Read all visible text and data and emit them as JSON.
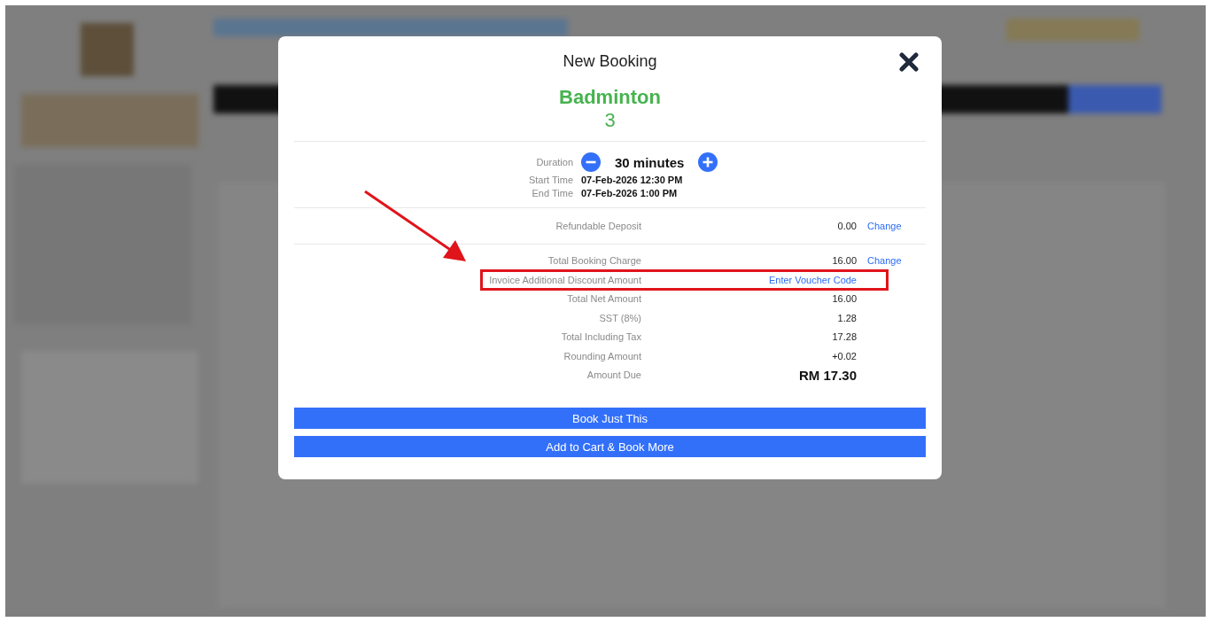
{
  "dialog": {
    "title": "New Booking",
    "facility": "Badminton",
    "court": "3",
    "duration": {
      "label": "Duration",
      "value": "30 minutes"
    },
    "times": [
      {
        "label": "Start Time",
        "value": "07-Feb-2026 12:30 PM"
      },
      {
        "label": "End Time",
        "value": "07-Feb-2026 1:00 PM"
      }
    ],
    "deposit_rows": [
      {
        "label": "Refundable Deposit",
        "value": "0.00",
        "action": "Change",
        "highlighted": false
      }
    ],
    "charge_rows": [
      {
        "kind": "amount",
        "label": "Total Booking Charge",
        "value": "16.00",
        "action": "Change",
        "highlighted": false
      },
      {
        "kind": "link",
        "label": "Invoice Additional Discount Amount",
        "value": "Enter Voucher Code",
        "highlighted": true
      },
      {
        "kind": "amount",
        "label": "Total Net Amount",
        "value": "16.00",
        "highlighted": false
      },
      {
        "kind": "amount",
        "label": "SST (8%)",
        "value": "1.28",
        "highlighted": false
      },
      {
        "kind": "amount",
        "label": "Total Including Tax",
        "value": "17.28",
        "highlighted": false
      },
      {
        "kind": "amount",
        "label": "Rounding Amount",
        "value": "+0.02",
        "highlighted": false
      },
      {
        "kind": "total",
        "label": "Amount Due",
        "value": "RM 17.30",
        "highlighted": false
      }
    ],
    "buttons": [
      "Book Just This",
      "Add to Cart & Book More"
    ],
    "annotation_arrow": true
  }
}
